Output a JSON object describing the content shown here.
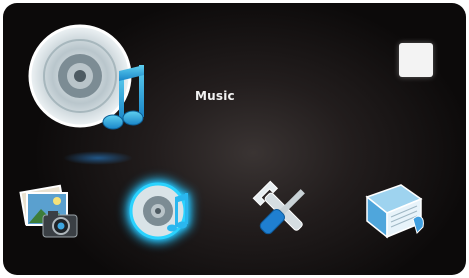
{
  "header": {
    "title": "Music"
  },
  "hero": {
    "icon": "music-disc-icon"
  },
  "status": {
    "icon": "stop-square-icon"
  },
  "menu": {
    "selected_index": 1,
    "items": [
      {
        "icon": "photos-icon"
      },
      {
        "icon": "music-icon"
      },
      {
        "icon": "settings-tools-icon"
      },
      {
        "icon": "ebook-icon"
      }
    ]
  },
  "colors": {
    "accent": "#2ad3ff",
    "background": "#1c1818",
    "text": "#f2f2f2"
  }
}
